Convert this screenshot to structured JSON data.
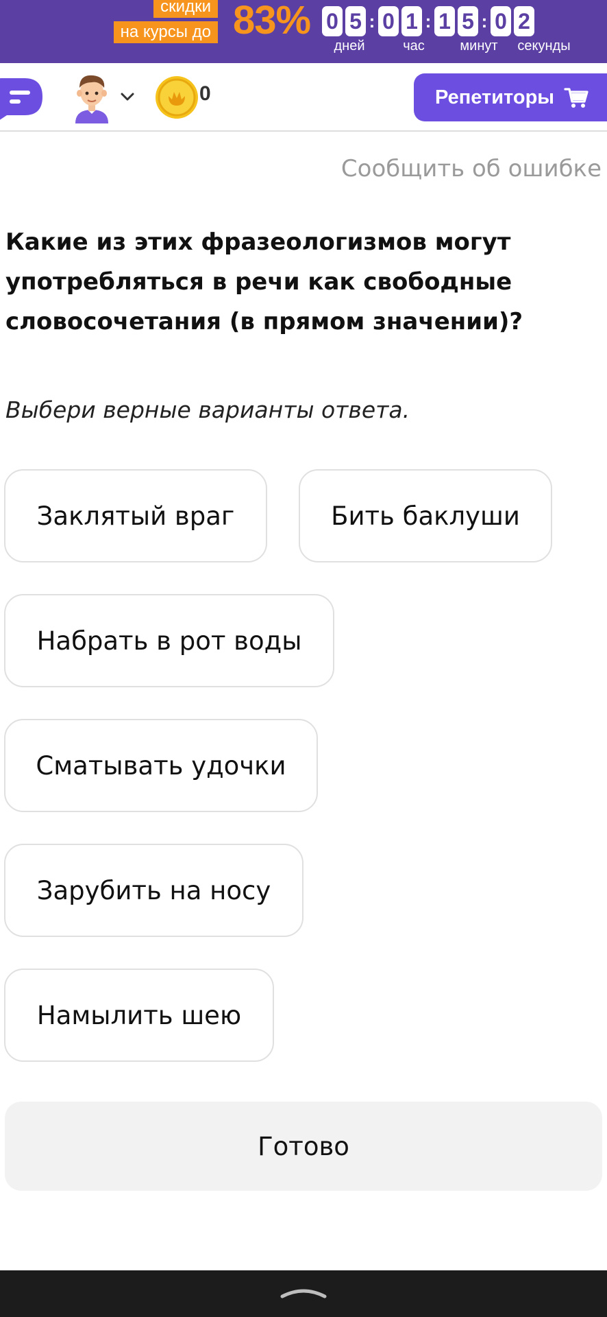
{
  "promo": {
    "tag_line1": "скидки",
    "tag_line2": "на курсы до",
    "percent": "83%",
    "timer": {
      "days": [
        "0",
        "5"
      ],
      "hours": [
        "0",
        "1"
      ],
      "minutes": [
        "1",
        "5"
      ],
      "seconds": [
        "0",
        "2"
      ],
      "labels": {
        "days": "дней",
        "hours": "час",
        "minutes": "минут",
        "seconds": "секунды"
      }
    }
  },
  "header": {
    "coin_count": "0",
    "tutors_label": "Репетиторы"
  },
  "report_error": "Сообщить об ошибке",
  "question": "Какие из этих фразеологизмов могут употребляться в речи как свободные словосочетания (в прямом значении)?",
  "instruction": "Выбери верные варианты ответа.",
  "options": [
    "Заклятый враг",
    "Бить баклуши",
    "Набрать в рот воды",
    "Сматывать удочки",
    "Зарубить на носу",
    "Намылить шею"
  ],
  "done_label": "Готово",
  "colors": {
    "brand_purple": "#5b3fa3",
    "button_purple": "#6c4ee0",
    "promo_orange": "#f7941d",
    "coin_gold": "#f6c21c"
  }
}
